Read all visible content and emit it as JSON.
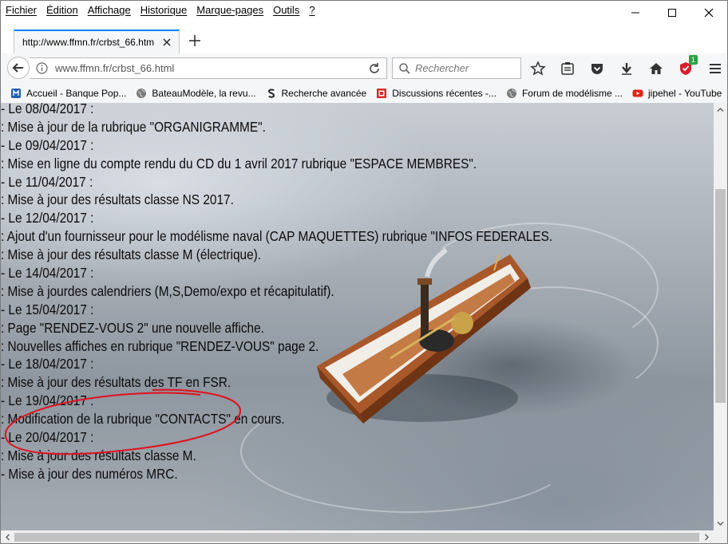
{
  "menu": {
    "items": [
      "Fichier",
      "Édition",
      "Affichage",
      "Historique",
      "Marque-pages",
      "Outils",
      "?"
    ]
  },
  "window_controls": {
    "minimize": "minimize-icon",
    "maximize": "maximize-icon",
    "close": "close-icon"
  },
  "tab": {
    "title": "http://www.ffmn.fr/crbst_66.htm"
  },
  "navbar": {
    "url": "www.ffmn.fr/crbst_66.html",
    "search_placeholder": "Rechercher",
    "addon_badge": "1"
  },
  "bookmarks": [
    {
      "label": "Accueil - Banque Pop...",
      "icon": "bank-icon",
      "color": "#1f5fb5"
    },
    {
      "label": "BateauModèle, la revu...",
      "icon": "globe-icon",
      "color": "#6d6d6d"
    },
    {
      "label": "Recherche avancée",
      "icon": "dark-s-icon",
      "color": "#222222"
    },
    {
      "label": "Discussions récentes -...",
      "icon": "forum-icon",
      "color": "#d62a2a"
    },
    {
      "label": "Forum de modélisme ...",
      "icon": "globe-icon",
      "color": "#6d6d6d"
    },
    {
      "label": "jipehel - YouTube",
      "icon": "youtube-icon",
      "color": "#e62117"
    }
  ],
  "content": {
    "lines": [
      "- Le 08/04/2017 :",
      ": Mise à jour de la rubrique \"ORGANIGRAMME\".",
      "- Le 09/04/2017 :",
      ": Mise en ligne du compte rendu du CD du 1 avril 2017 rubrique \"ESPACE MEMBRES\".",
      "- Le 11/04/2017 :",
      ": Mise à jour des résultats classe NS 2017.",
      "- Le 12/04/2017 :",
      ": Ajout d'un fournisseur pour le modélisme naval (CAP MAQUETTES) rubrique \"INFOS FEDERALES.",
      ": Mise à jour des résultats classe M (électrique).",
      "- Le 14/04/2017 :",
      ": Mise à jourdes calendriers (M,S,Demo/expo et récapitulatif).",
      "- Le 15/04/2017 :",
      ": Page \"RENDEZ-VOUS 2\" une nouvelle affiche.",
      ": Nouvelles affiches en rubrique \"RENDEZ-VOUS\" page 2.",
      "- Le 18/04/2017 :",
      ": Mise à jour des résultats des TF en FSR.",
      "- Le 19/04/2017 :",
      ": Modification de la rubrique \"CONTACTS\" en cours.",
      "- Le 20/04/2017 :",
      ": Mise à jour des résultats classe M.",
      "- Mise à jour des numéros MRC."
    ]
  },
  "colors": {
    "accent": "#0a84ff",
    "annotation": "#e0101c",
    "badge": "#2ea043"
  }
}
